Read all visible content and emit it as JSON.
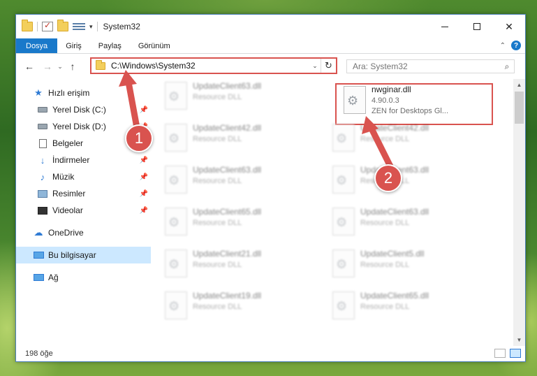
{
  "window": {
    "title": "System32",
    "controls": {
      "minimize": "",
      "maximize": "",
      "close": "✕"
    }
  },
  "ribbon": {
    "tabs": [
      "Dosya",
      "Giriş",
      "Paylaş",
      "Görünüm"
    ]
  },
  "nav": {
    "back": "←",
    "forward": "→",
    "recent": "⌄",
    "up": "↑",
    "address": "C:\\Windows\\System32",
    "refresh": "↻",
    "search_placeholder": "Ara: System32"
  },
  "sidebar": {
    "items": [
      {
        "label": "Hızlı erişim",
        "icon": "star-icon"
      },
      {
        "label": "Yerel Disk (C:)",
        "icon": "disk-icon",
        "pinned": true
      },
      {
        "label": "Yerel Disk (D:)",
        "icon": "disk-icon",
        "pinned": true
      },
      {
        "label": "Belgeler",
        "icon": "documents-icon",
        "pinned": true
      },
      {
        "label": "İndirmeler",
        "icon": "download-icon",
        "pinned": true
      },
      {
        "label": "Müzik",
        "icon": "music-icon",
        "pinned": true
      },
      {
        "label": "Resimler",
        "icon": "pictures-icon",
        "pinned": true
      },
      {
        "label": "Videolar",
        "icon": "videos-icon",
        "pinned": true
      },
      {
        "label": "OneDrive",
        "icon": "cloud-icon"
      },
      {
        "label": "Bu bilgisayar",
        "icon": "computer-icon",
        "selected": true
      },
      {
        "label": "Ağ",
        "icon": "network-icon"
      }
    ]
  },
  "files": {
    "left_column": [
      {
        "name": "UpdateClient63.dll",
        "desc": "Resource DLL"
      },
      {
        "name": "UpdateClient42.dll",
        "desc": "Resource DLL"
      },
      {
        "name": "UpdateClient63.dll",
        "desc": "Resource DLL"
      },
      {
        "name": "UpdateClient65.dll",
        "desc": "Resource DLL"
      },
      {
        "name": "UpdateClient21.dll",
        "desc": "Resource DLL"
      },
      {
        "name": "UpdateClient19.dll",
        "desc": "Resource DLL"
      }
    ],
    "right_column": [
      {
        "name": "UpdateClient42.dll",
        "desc": "Resource DLL"
      },
      {
        "name": "UpdateClient63.dll",
        "desc": "Resource DLL"
      },
      {
        "name": "UpdateClient63.dll",
        "desc": "Resource DLL"
      },
      {
        "name": "UpdateClient5.dll",
        "desc": "Resource DLL"
      },
      {
        "name": "UpdateClient65.dll",
        "desc": "Resource DLL"
      }
    ],
    "highlighted": {
      "name": "nwginar.dll",
      "version": "4.90.0.3",
      "desc": "ZEN for Desktops Gl..."
    }
  },
  "status": {
    "count": "198 öğe"
  },
  "annotations": {
    "step1": "1",
    "step2": "2",
    "color": "#d9534f"
  }
}
